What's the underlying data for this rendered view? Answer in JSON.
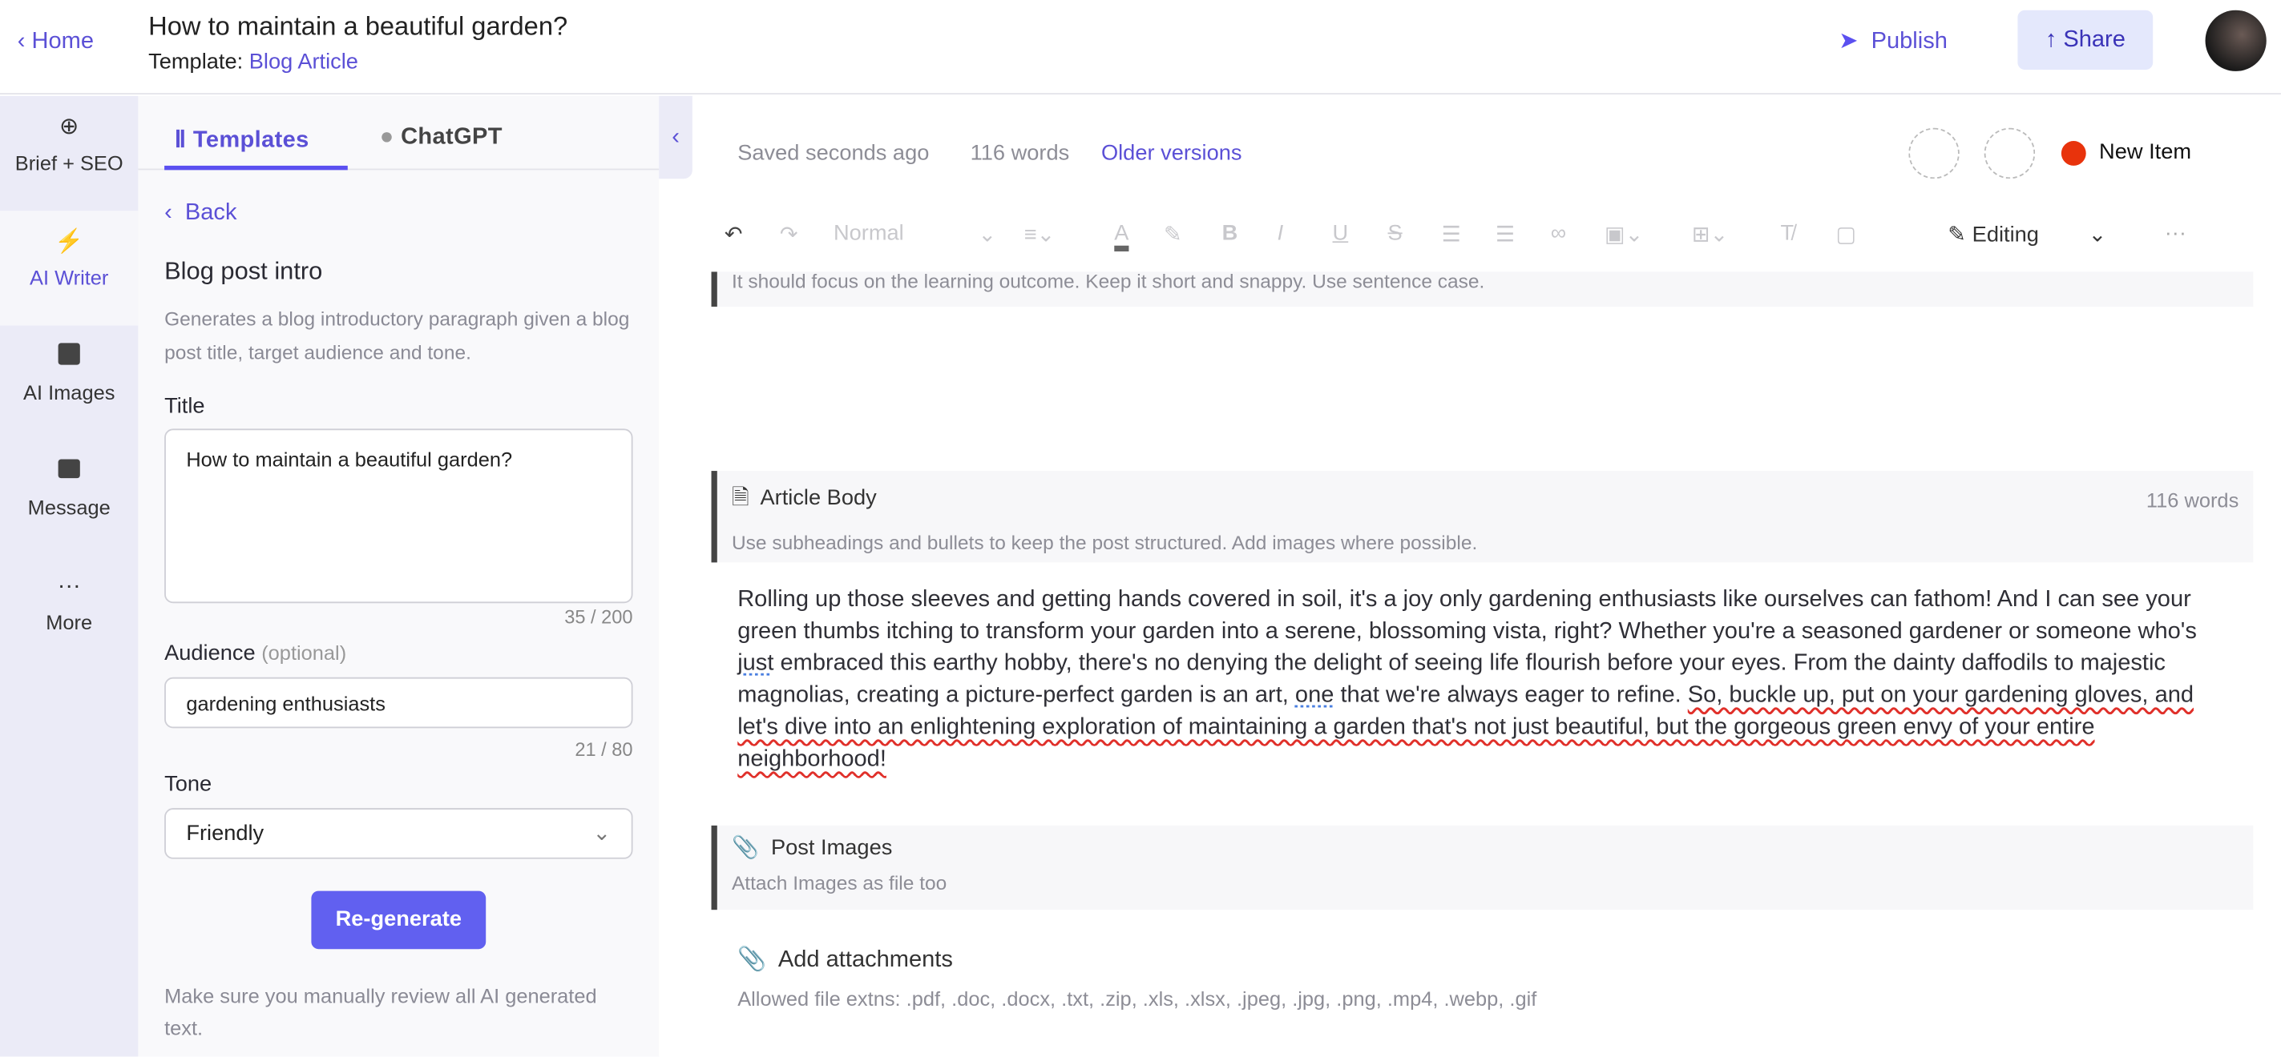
{
  "header": {
    "home_label": "Home",
    "title": "How to maintain a beautiful garden?",
    "template_prefix": "Template:",
    "template_name": "Blog Article",
    "publish_label": "Publish",
    "share_label": "Share"
  },
  "rail": {
    "items": [
      {
        "label": "Brief + SEO",
        "icon": "crosshair-icon"
      },
      {
        "label": "AI Writer",
        "icon": "lightning-icon",
        "active": true
      },
      {
        "label": "AI Images",
        "icon": "image-icon"
      },
      {
        "label": "Message",
        "icon": "message-icon"
      },
      {
        "label": "More",
        "icon": "more-icon"
      }
    ]
  },
  "panel": {
    "tabs": [
      {
        "label": "Templates",
        "active": true
      },
      {
        "label": "ChatGPT"
      }
    ],
    "back_label": "Back",
    "template_title": "Blog post intro",
    "description": "Generates a blog introductory paragraph given a blog post title, target audience and tone.",
    "title_label": "Title",
    "title_value": "How to maintain a beautiful garden?",
    "title_count": "35 / 200",
    "audience_label": "Audience",
    "audience_optional": "(optional)",
    "audience_value": "gardening enthusiasts",
    "audience_count": "21 / 80",
    "tone_label": "Tone",
    "tone_value": "Friendly",
    "regenerate_label": "Re-generate",
    "note": "Make sure you manually review all AI generated text."
  },
  "editor": {
    "saved": "Saved seconds ago",
    "words": "116 words",
    "older_versions": "Older versions",
    "status_label": "New Item",
    "status_color": "#e8330c",
    "format_value": "Normal",
    "mode_label": "Editing",
    "block1_hint": "It should focus on the learning outcome. Keep it short and snappy. Use sentence case.",
    "body_title": "Article Body",
    "body_words": "116 words",
    "body_hint": "Use subheadings and bullets to keep the post structured. Add images where possible.",
    "body_p1": "Rolling up those sleeves and getting hands covered in soil, it's a joy only gardening enthusiasts like ourselves can fathom! And I can see your green thumbs itching to transform your garden into a serene, blossoming vista, right? Whether you're a seasoned gardener or someone who's ",
    "body_w1": "just",
    "body_p2": " embraced this earthy hobby, there's no denying the delight of seeing life flourish before your eyes. From the dainty daffodils to majestic magnolias, creating a picture-perfect garden is an art, ",
    "body_w2": "one",
    "body_p3": " that we're always eager to refine. ",
    "body_p4": "So, buckle up, put on your gardening gloves, and let's dive into an enlightening exploration of maintaining a garden that's not just beautiful, but the gorgeous green envy of your entire neighborhood!",
    "images_title": "Post Images",
    "images_hint": "Attach Images as file too",
    "attach_title": "Add attachments",
    "attach_hint": "Allowed file extns: .pdf, .doc, .docx, .txt, .zip, .xls, .xlsx, .jpeg, .jpg, .png, .mp4, .webp, .gif"
  },
  "colors": {
    "accent": "#5b50d6",
    "button": "#6160f0",
    "share_bg": "#e4e8fc"
  }
}
